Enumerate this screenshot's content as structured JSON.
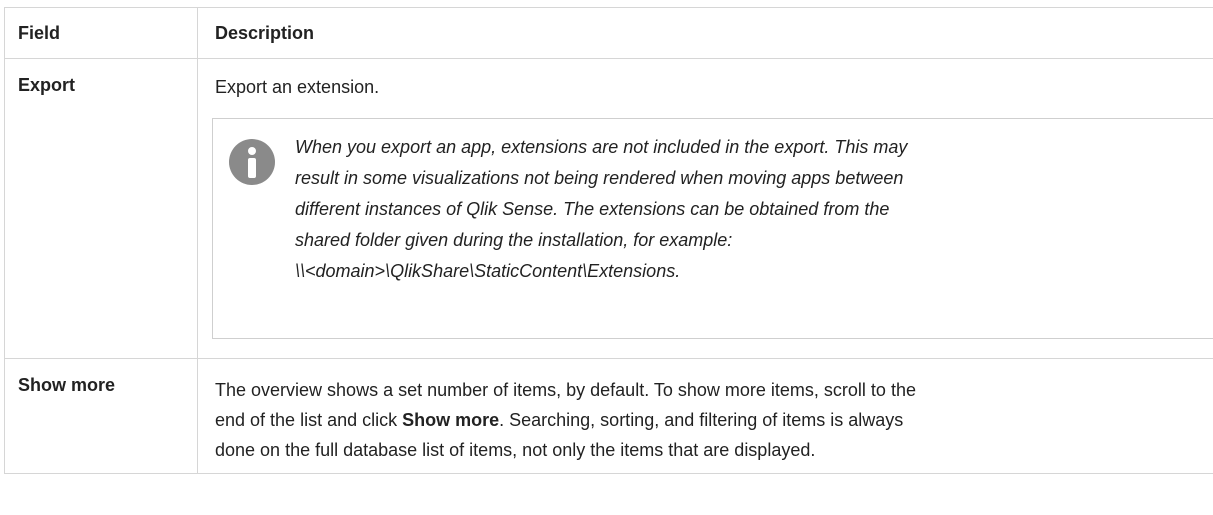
{
  "table": {
    "headers": {
      "field": "Field",
      "description": "Description"
    },
    "rows": [
      {
        "field": "Export",
        "description": "Export an extension.",
        "note": {
          "icon": "info-icon",
          "lines": [
            "When you export an app, extensions are not included in the export. This may",
            "result in some visualizations not being rendered when moving apps between",
            "different instances of Qlik Sense. The extensions can be obtained from the",
            "shared folder given during the installation, for example:",
            "\\\\<domain>\\QlikShare\\StaticContent\\Extensions."
          ]
        }
      },
      {
        "field": "Show more",
        "line1": "The overview shows a set number of items, by default. To show more items, scroll to the",
        "line2_pre": "end of the list and click ",
        "line2_bold": "Show more",
        "line2_post": ". Searching, sorting, and filtering of items is always",
        "line3": "done on the full database list of items, not only the items that are displayed."
      }
    ]
  },
  "colors": {
    "border": "#d6d6d6",
    "icon": "#8a8a8a",
    "text": "#222222"
  }
}
